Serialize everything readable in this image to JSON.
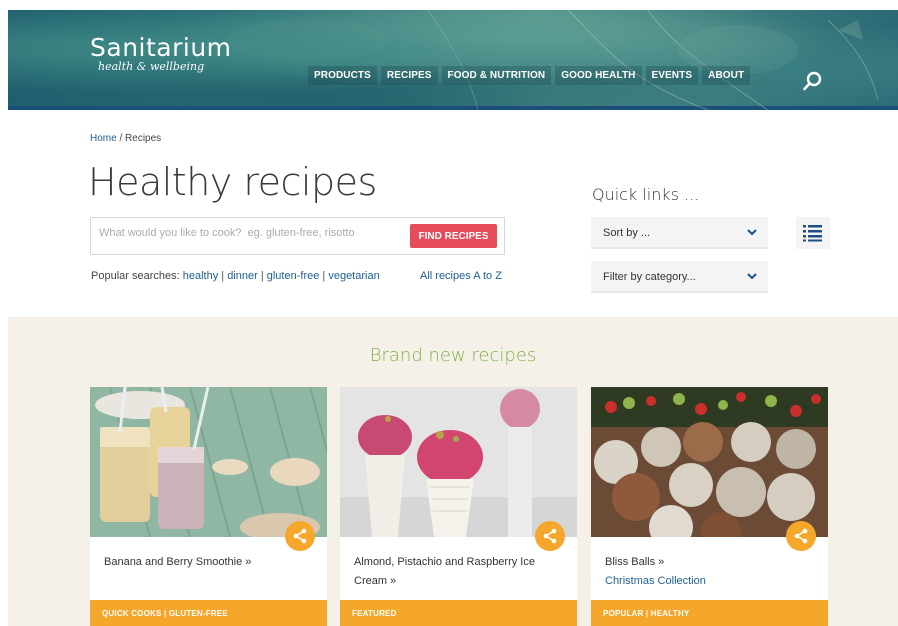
{
  "header": {
    "logo_main": "Sanitarium",
    "logo_sub": "health & wellbeing",
    "nav": [
      "PRODUCTS",
      "RECIPES",
      "FOOD & NUTRITION",
      "GOOD HEALTH",
      "EVENTS",
      "ABOUT"
    ]
  },
  "breadcrumb": {
    "home": "Home",
    "separator": " / ",
    "current": "Recipes"
  },
  "page_title": "Healthy recipes",
  "search": {
    "placeholder": "What would you like to cook?  eg. gluten-free, risotto",
    "button": "FIND RECIPES"
  },
  "popular": {
    "label": "Popular searches: ",
    "items": [
      "healthy",
      "dinner",
      "gluten-free",
      "vegetarian"
    ],
    "all_link": "All recipes A to Z"
  },
  "quick_links": {
    "title": "Quick links ...",
    "sort": "Sort by ...",
    "filter": "Filter by category..."
  },
  "brand": {
    "title": "Brand new recipes",
    "cards": [
      {
        "title": "Banana and Berry Smoothie »",
        "sub": "",
        "tags": "QUICK COOKS  |  GLUTEN-FREE"
      },
      {
        "title": "Almond, Pistachio and Raspberry Ice Cream »",
        "sub": "",
        "tags": "FEATURED"
      },
      {
        "title": "Bliss Balls »",
        "sub": "Christmas Collection",
        "tags": "POPULAR  |  HEALTHY"
      }
    ]
  },
  "colors": {
    "accent_red": "#e64b5b",
    "accent_orange": "#f5a72c",
    "link_blue": "#1d5f93",
    "green_title": "#7fb24e",
    "header_bar": "#1b4f7a"
  }
}
